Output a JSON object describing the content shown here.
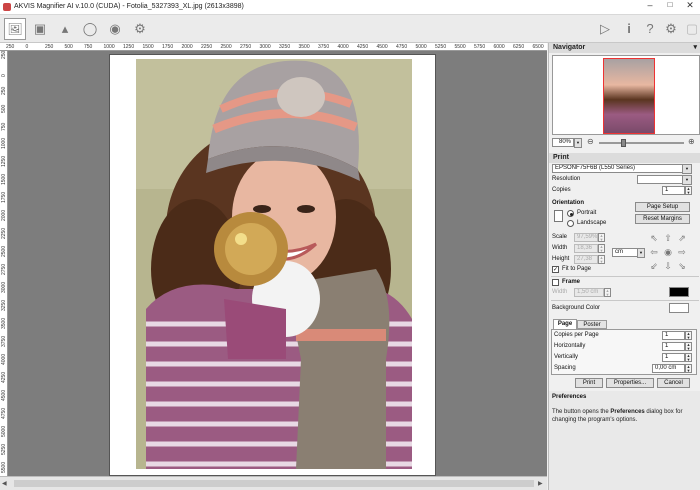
{
  "window": {
    "title": "AKVIS Magnifier AI v.10.0 (CUDA) - Fotolia_5327393_XL.jpg (2613x3898)"
  },
  "toolbar": {
    "left_icons": [
      "open-image-icon",
      "save-icon",
      "print-icon",
      "share-icon",
      "batch-icon",
      "preferences-gear-icon"
    ],
    "right_icons": [
      "run-icon",
      "info-icon",
      "help-icon",
      "settings-icon",
      "message-icon"
    ]
  },
  "ruler": {
    "top_labels": [
      "250",
      "0",
      "250",
      "500",
      "750",
      "1000",
      "1250",
      "1500",
      "1750",
      "2000",
      "2250",
      "2500",
      "2750",
      "3000",
      "3250",
      "3500",
      "3750",
      "4000",
      "4250",
      "4500",
      "4750",
      "5000",
      "5250",
      "5500",
      "5750",
      "6000",
      "6250",
      "6500",
      "6750"
    ],
    "left_labels": [
      "250",
      "0",
      "250",
      "500",
      "750",
      "1000",
      "1250",
      "1500",
      "1750",
      "2000",
      "2250",
      "2500",
      "2750",
      "3000",
      "3250",
      "3500",
      "3750",
      "4000",
      "4250",
      "4500",
      "4750",
      "5000",
      "5250",
      "5500"
    ]
  },
  "navigator": {
    "title": "Navigator",
    "zoom": "80%"
  },
  "print": {
    "title": "Print",
    "printer": "EPSONF75F6B (L550 Series)",
    "resolution_label": "Resolution",
    "resolution_value": "",
    "copies_label": "Copies",
    "copies_value": "1",
    "orientation_label": "Orientation",
    "portrait": "Portrait",
    "landscape": "Landscape",
    "page_setup": "Page Setup",
    "reset_margins": "Reset Margins",
    "scale_label": "Scale",
    "scale_value": "97,59%",
    "width_label": "Width",
    "width_value": "18,36",
    "height_label": "Height",
    "height_value": "27,38",
    "unit": "cm",
    "fit_to_page": "Fit to Page",
    "frame_label": "Frame",
    "frame_width_label": "Width",
    "frame_width_value": "1,50 cm",
    "frame_color": "#000000",
    "background_label": "Background Color",
    "background_color": "#ffffff",
    "tabs": [
      "Page",
      "Poster"
    ],
    "copies_per_page_label": "Copies per Page",
    "copies_per_page": "1",
    "horizontally_label": "Horizontally",
    "horizontally": "1",
    "vertically_label": "Vertically",
    "vertically": "1",
    "spacing_label": "Spacing",
    "spacing": "0,00 cm",
    "print_btn": "Print",
    "properties_btn": "Properties...",
    "cancel_btn": "Cancel"
  },
  "preferences": {
    "title": "Preferences",
    "desc_pre": "The button opens the ",
    "desc_bold": "Preferences",
    "desc_post": " dialog box for changing the program's options."
  }
}
